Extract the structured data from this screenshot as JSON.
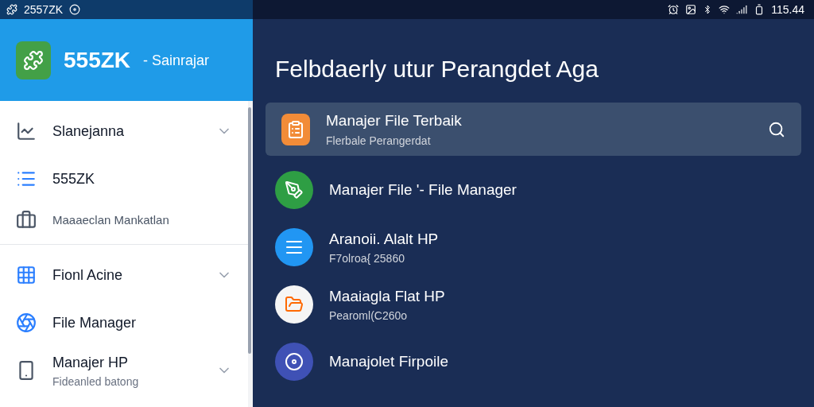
{
  "status_bar": {
    "left_text": "2557ZK",
    "time": "115.44"
  },
  "drawer": {
    "header": {
      "app_name": "555ZK",
      "subtitle": "- Sainrajar"
    },
    "sections": [
      {
        "items": [
          {
            "label": "Slanejanna",
            "expandable": true
          },
          {
            "label": "555ZK",
            "expandable": false
          },
          {
            "label": "Maaaeclan Mankatlan",
            "expandable": false,
            "kind": "minor"
          }
        ]
      },
      {
        "items": [
          {
            "label": "Fionl Acine",
            "expandable": true
          },
          {
            "label": "File Manager",
            "expandable": false
          },
          {
            "label": "Manajer HP",
            "sublabel": "Fideanled batong",
            "expandable": true
          }
        ]
      }
    ]
  },
  "main": {
    "title": "Felbdaerly utur Perangdet Aga",
    "apps": [
      {
        "title": "Manajer File Terbaik",
        "subtitle": "Flerbale Perangerdat",
        "selected": true,
        "color": "#f28c38"
      },
      {
        "title": "Manajer File '- File Manager",
        "selected": false,
        "color": "#2e9e44"
      },
      {
        "title": "Aranoii. Alalt HP",
        "subtitle": "F7olroa{ 25860",
        "selected": false,
        "color": "#2196f3"
      },
      {
        "title": "Maaiagla Flat HP",
        "subtitle": "Pearoml(C260o",
        "selected": false,
        "color": "#f5f5f5"
      },
      {
        "title": "Manajolet Firpoile",
        "selected": false,
        "color": "#3f51b5"
      }
    ]
  }
}
